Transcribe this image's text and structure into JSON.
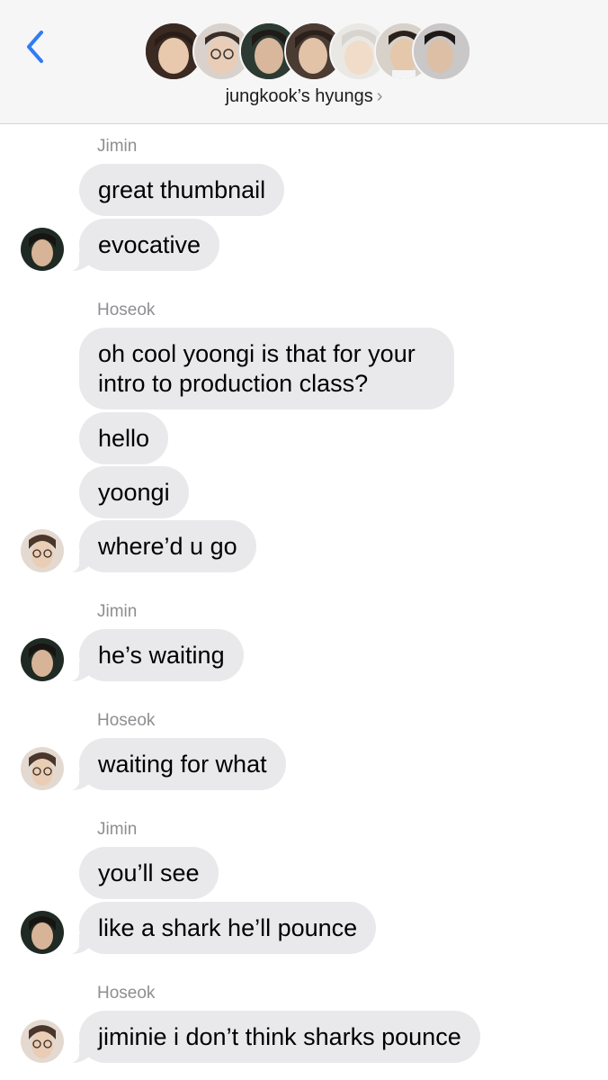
{
  "header": {
    "back_icon": "chevron-left-icon",
    "group_title": "jungkook’s hyungs",
    "title_chevron": "›",
    "accent_color": "#2f7cf6",
    "member_avatars": [
      {
        "label": "member-1",
        "bg": "#3a2a22",
        "skin": "#e8c9ad"
      },
      {
        "label": "member-2",
        "bg": "#d9d2cc",
        "skin": "#e9cdb7"
      },
      {
        "label": "member-3",
        "bg": "#2c3a33",
        "skin": "#d8b79c"
      },
      {
        "label": "member-4",
        "bg": "#4a3b33",
        "skin": "#e2c3a8"
      },
      {
        "label": "member-5",
        "bg": "#eae8e4",
        "skin": "#f0dcc8"
      },
      {
        "label": "member-6",
        "bg": "#d7d1ca",
        "skin": "#e5c7ac"
      },
      {
        "label": "member-7",
        "bg": "#c9c7c7",
        "skin": "#dcbfa5"
      }
    ]
  },
  "messages": {
    "bubble_color": "#e9e9eb",
    "sender_1": "Jimin",
    "m1": "great thumbnail",
    "m2": "evocative",
    "sender_2": "Hoseok",
    "m3": "oh cool yoongi is that for your intro to production class?",
    "m4": "hello",
    "m5": "yoongi",
    "m6": "where’d u go",
    "sender_3": "Jimin",
    "m7": "he’s waiting",
    "sender_4": "Hoseok",
    "m8": "waiting for what",
    "sender_5": "Jimin",
    "m9": "you’ll see",
    "m10": "like a shark he’ll pounce",
    "sender_6": "Hoseok",
    "m11": "jiminie i don’t think sharks pounce"
  }
}
